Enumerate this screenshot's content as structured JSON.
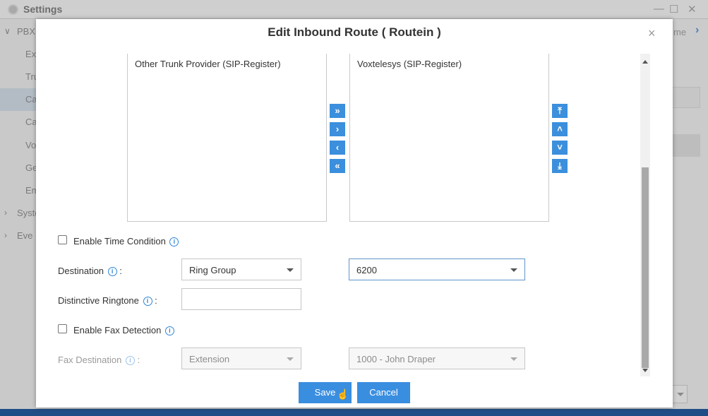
{
  "background": {
    "window_title": "Settings",
    "window_controls": [
      "—",
      "☐",
      "✕"
    ],
    "sidebar_items": [
      "PBX",
      "Ex",
      "Tru",
      "Ca",
      "Ca",
      "Vo",
      "Ge",
      "Em",
      "Syste",
      "Eve"
    ],
    "right_partial_text": "me",
    "right_arrow": "›"
  },
  "dialog": {
    "title": "Edit Inbound Route ( Routein )",
    "close": "×",
    "available_trunks": [
      "Other Trunk Provider (SIP-Register)"
    ],
    "selected_trunks": [
      "Voxtelesys (SIP-Register)"
    ],
    "move_buttons": [
      "»",
      "›",
      "‹",
      "«"
    ],
    "order_buttons": [
      "⤒",
      "˄",
      "˅",
      "⤓"
    ],
    "info_glyph": "i",
    "enable_time_condition": {
      "label": "Enable Time Condition",
      "checked": false
    },
    "destination": {
      "label": "Destination",
      "colon": ":",
      "type": "Ring Group",
      "value": "6200"
    },
    "distinctive_ringtone": {
      "label": "Distinctive Ringtone",
      "colon": ":",
      "value": ""
    },
    "enable_fax_detection": {
      "label": "Enable Fax Detection",
      "checked": false
    },
    "fax_destination": {
      "label": "Fax Destination",
      "colon": ":",
      "type": "Extension",
      "value": "1000 - John Draper"
    },
    "buttons": {
      "save": "Save",
      "cancel": "Cancel"
    }
  },
  "colors": {
    "accent": "#3a8ee0",
    "info": "#2e86d6",
    "taskbar": "#1f4e86"
  }
}
